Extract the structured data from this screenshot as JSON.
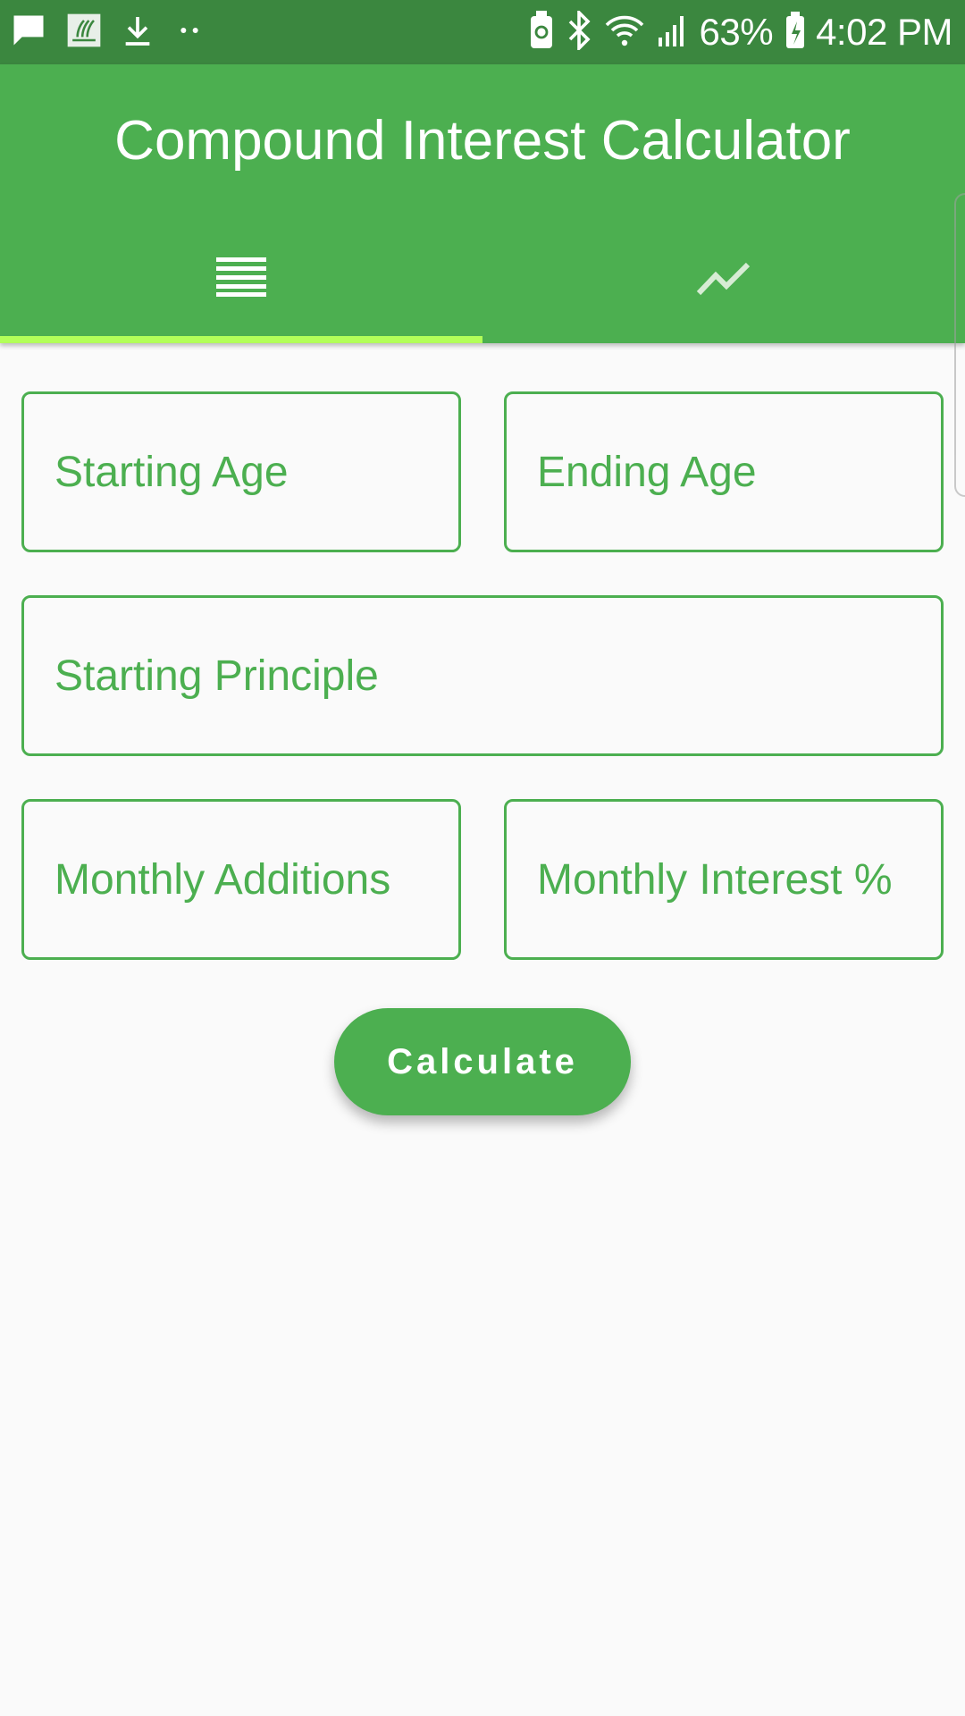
{
  "status_bar": {
    "battery_percent": "63%",
    "time": "4:02 PM",
    "icons": [
      "message-icon",
      "app-notification-icon",
      "download-icon",
      "more-dots-icon",
      "battery-saver-icon",
      "bluetooth-icon",
      "wifi-icon",
      "signal-icon",
      "battery-charging-icon"
    ]
  },
  "app_bar": {
    "title": "Compound Interest Calculator",
    "tabs": [
      {
        "icon": "list-icon",
        "selected": true
      },
      {
        "icon": "trending-chart-icon",
        "selected": false
      }
    ]
  },
  "form": {
    "starting_age": {
      "placeholder": "Starting Age",
      "value": ""
    },
    "ending_age": {
      "placeholder": "Ending Age",
      "value": ""
    },
    "starting_principle": {
      "placeholder": "Starting Principle",
      "value": ""
    },
    "monthly_additions": {
      "placeholder": "Monthly Additions",
      "value": ""
    },
    "monthly_interest": {
      "placeholder": "Monthly Interest %",
      "value": ""
    },
    "calculate_label": "Calculate"
  },
  "colors": {
    "primary": "#4caf50",
    "primary_dark": "#3b873f",
    "accent": "#b2ff59",
    "background": "#fafafa"
  }
}
